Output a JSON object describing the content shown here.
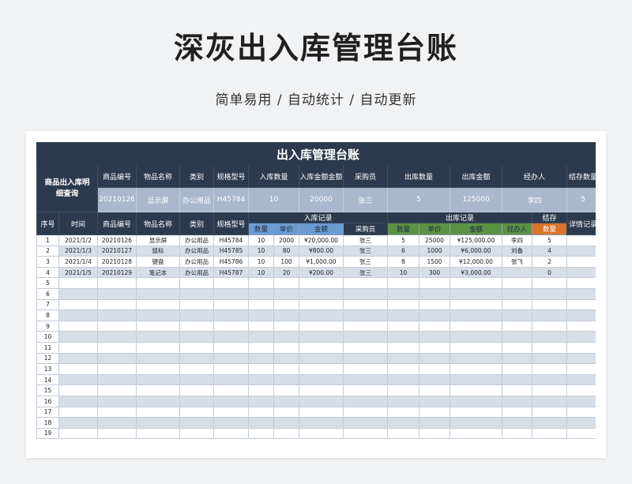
{
  "page": {
    "title": "深灰出入库管理台账",
    "subtitle": "简单易用 / 自动统计 / 自动更新"
  },
  "sheet": {
    "banner": "出入库管理台账",
    "query_label": "商品出入库明细查询",
    "query_headers": [
      "商品编号",
      "物品名称",
      "类别",
      "规格型号",
      "入库数量",
      "入库金额金额",
      "采购员",
      "出库数量",
      "出库金额",
      "经办人",
      "结存数量"
    ],
    "query_values": [
      "20210126",
      "显示屏",
      "办公用品",
      "H45784",
      "10",
      "20000",
      "张三",
      "5",
      "125000",
      "李四",
      "5"
    ],
    "header_main": {
      "seq": "序号",
      "time": "时间",
      "code": "商品编号",
      "name": "物品名称",
      "category": "类别",
      "model": "规格型号",
      "in_group": "入库记录",
      "out_group": "出库记录",
      "stock_group": "结存",
      "detail": "详情记录"
    },
    "header_sub": {
      "in_qty": "数量",
      "in_price": "单价",
      "in_amount": "金额",
      "buyer": "采购员",
      "out_qty": "数量",
      "out_price": "单价",
      "out_amount": "金额",
      "handler": "经办人",
      "stock_qty": "数量"
    },
    "rows": [
      [
        "1",
        "2021/1/2",
        "20210126",
        "显示屏",
        "办公用品",
        "H45784",
        "10",
        "2000",
        "¥20,000.00",
        "张三",
        "5",
        "25000",
        "¥125,000.00",
        "李四",
        "5",
        ""
      ],
      [
        "2",
        "2021/1/3",
        "20210127",
        "鼠标",
        "办公用品",
        "H45785",
        "10",
        "80",
        "¥800.00",
        "张三",
        "6",
        "1000",
        "¥6,000.00",
        "刘备",
        "4",
        ""
      ],
      [
        "3",
        "2021/1/4",
        "20210128",
        "键盘",
        "办公用品",
        "H45786",
        "10",
        "100",
        "¥1,000.00",
        "张三",
        "8",
        "1500",
        "¥12,000.00",
        "张飞",
        "2",
        ""
      ],
      [
        "4",
        "2021/1/5",
        "20210129",
        "笔记本",
        "办公用品",
        "H45787",
        "10",
        "20",
        "¥200.00",
        "张三",
        "10",
        "300",
        "¥3,000.00",
        "",
        "0",
        ""
      ],
      [
        "5"
      ],
      [
        "6"
      ],
      [
        "7"
      ],
      [
        "8"
      ],
      [
        "9"
      ],
      [
        "10"
      ],
      [
        "11"
      ],
      [
        "12"
      ],
      [
        "13"
      ],
      [
        "14"
      ],
      [
        "15"
      ],
      [
        "16"
      ],
      [
        "17"
      ],
      [
        "18"
      ],
      [
        "19"
      ]
    ]
  },
  "colors": {
    "header_dark": "#2c3a4d",
    "query_value_bg": "#a9b8cc",
    "row_alt": "#d7dee8",
    "in_accent": "#6a9bd1",
    "out_accent": "#5c9244",
    "stock_accent": "#d9742a"
  }
}
